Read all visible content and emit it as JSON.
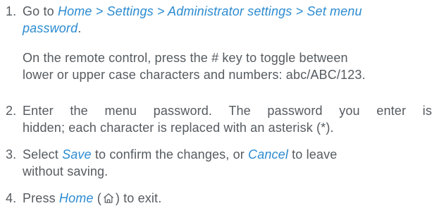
{
  "steps": [
    {
      "number": "1.",
      "parts": {
        "prefix": "Go to ",
        "path": "Home > Settings > Administrator settings > Set menu",
        "path_cont": "password",
        "suffix": "."
      },
      "note": {
        "line1": "On the remote control, press the # key to toggle between",
        "line2": "lower or upper case characters and numbers: abc/ABC/123."
      }
    },
    {
      "number": "2.",
      "line1": "Enter the menu password. The password you enter is",
      "line2": "hidden; each character is replaced with an asterisk (*)."
    },
    {
      "number": "3.",
      "parts": {
        "prefix": "Select ",
        "save": "Save",
        "middle": " to confirm the changes, or ",
        "cancel": "Cancel",
        "suffix": " to leave",
        "line2": "without saving."
      }
    },
    {
      "number": "4.",
      "parts": {
        "prefix": "Press ",
        "home": "Home",
        "open_paren": " (",
        "close_paren": ") to exit."
      },
      "icon": "home-icon"
    }
  ],
  "colors": {
    "text": "#555b60",
    "link": "#2c8bd1"
  }
}
